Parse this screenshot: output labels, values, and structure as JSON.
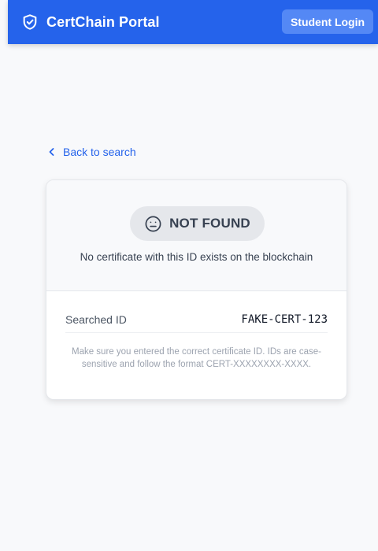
{
  "header": {
    "title": "CertChain Portal",
    "logo_icon": "shield-check-icon",
    "login_label": "Student Login",
    "background": "#2563eb"
  },
  "back": {
    "label": "Back to search",
    "icon": "chevron-left-icon"
  },
  "result": {
    "status_icon": "neutral-face-icon",
    "status_label": "NOT FOUND",
    "description": "No certificate with this ID exists on the blockchain",
    "searched_label": "Searched ID",
    "searched_value": "FAKE-CERT-123",
    "hint": "Make sure you entered the correct certificate ID. IDs are case-sensitive and follow the format CERT-XXXXXXXX-XXXX."
  }
}
